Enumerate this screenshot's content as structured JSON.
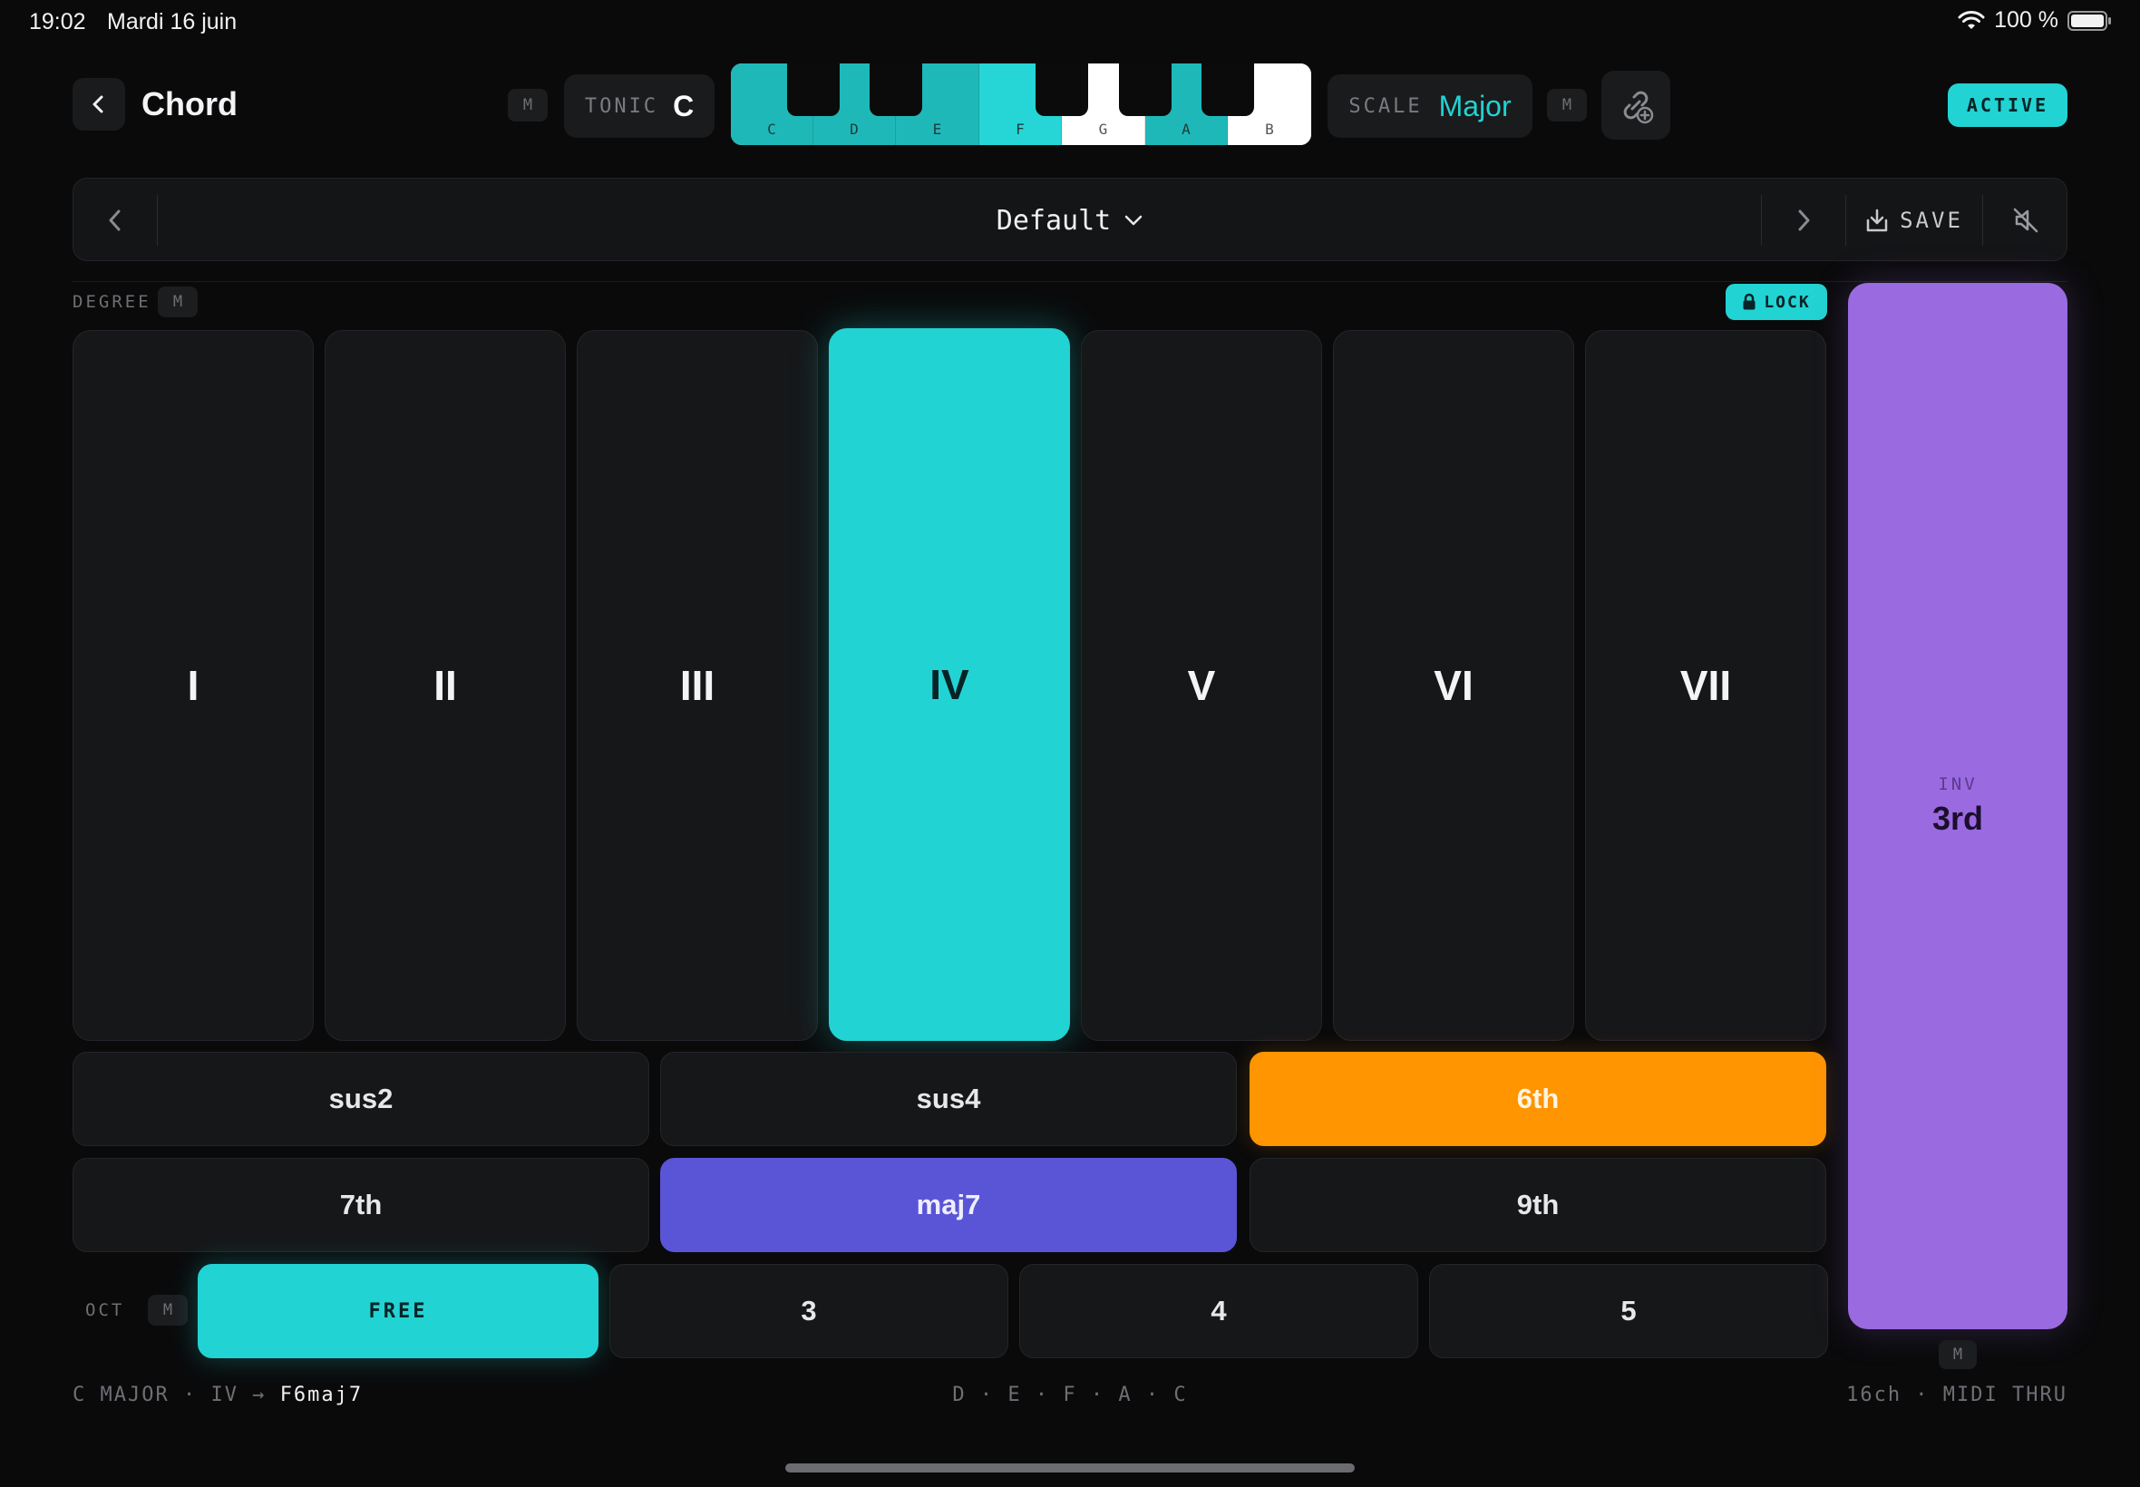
{
  "status_bar": {
    "time": "19:02",
    "date": "Mardi 16 juin",
    "battery_text": "100 %"
  },
  "header": {
    "title": "Chord",
    "midi_badge": "M",
    "tonic": {
      "label": "TONIC",
      "value": "C"
    },
    "scale": {
      "label": "SCALE",
      "value": "Major"
    },
    "keyboard_notes": [
      "C",
      "D",
      "E",
      "F",
      "G",
      "A",
      "B"
    ],
    "active_label": "ACTIVE"
  },
  "preset": {
    "name": "Default",
    "save_label": "SAVE"
  },
  "degree": {
    "label": "DEGREE",
    "lock_label": "LOCK",
    "pads": [
      "I",
      "II",
      "III",
      "IV",
      "V",
      "VI",
      "VII"
    ],
    "selected": "IV"
  },
  "extensions": {
    "row1": [
      "sus2",
      "sus4",
      "6th"
    ],
    "row2": [
      "7th",
      "maj7",
      "9th"
    ]
  },
  "octave": {
    "label": "OCT",
    "options": [
      "FREE",
      "3",
      "4",
      "5"
    ]
  },
  "inversion": {
    "label": "INV",
    "value": "3rd"
  },
  "footer": {
    "context": "C MAJOR · IV →",
    "chord": "F6maj7",
    "notes": "D · E · F · A · C",
    "midi": "16ch · MIDI THRU"
  },
  "colors": {
    "accent": "#22d3d3",
    "orange": "#ff9500",
    "indigo": "#5a55d6",
    "purple": "#9a6ae0"
  }
}
